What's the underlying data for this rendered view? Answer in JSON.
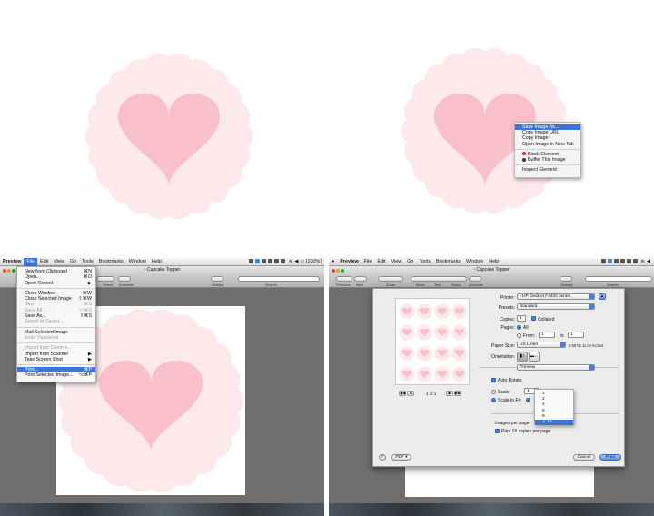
{
  "colors": {
    "badge": "#fde8ec",
    "heart": "#f9c0cb",
    "selection": "#3c74d8"
  },
  "context_menu": {
    "items": [
      {
        "label": "Save Image As...",
        "selected": true
      },
      {
        "label": "Copy Image URL"
      },
      {
        "label": "Copy Image"
      },
      {
        "label": "Open Image in New Tab"
      },
      {
        "label": "Block Element",
        "icon": "stop-icon"
      },
      {
        "label": "Buffer This Image",
        "icon": "buffer-icon"
      },
      {
        "label": "Inspect Element"
      }
    ]
  },
  "left_panel": {
    "menubar": [
      "Preview",
      "File",
      "Edit",
      "View",
      "Go",
      "Tools",
      "Bookmarks",
      "Window",
      "Help"
    ],
    "battery": "(100%)",
    "window_title": "Cupcake Topper",
    "toolbar": {
      "select": "Select",
      "annotate": "Annotate",
      "sidebar": "Sidebar",
      "search": "Search"
    },
    "file_menu": [
      {
        "label": "New from Clipboard",
        "shortcut": "⌘N"
      },
      {
        "label": "Open...",
        "shortcut": "⌘O"
      },
      {
        "label": "Open Recent",
        "shortcut": "▶"
      },
      {
        "sep": true
      },
      {
        "label": "Close Window",
        "shortcut": "⌘W"
      },
      {
        "label": "Close Selected Image",
        "shortcut": "⇧⌘W"
      },
      {
        "label": "Save",
        "shortcut": "⌘S",
        "disabled": true
      },
      {
        "label": "Save All",
        "shortcut": "⌥⌘S",
        "disabled": true
      },
      {
        "label": "Save As...",
        "shortcut": "⇧⌘S"
      },
      {
        "label": "Revert to Saved...",
        "disabled": true
      },
      {
        "sep": true
      },
      {
        "label": "Mail Selected Image"
      },
      {
        "label": "Enter Password",
        "disabled": true
      },
      {
        "sep": true
      },
      {
        "label": "Import from Camera...",
        "disabled": true
      },
      {
        "label": "Import from Scanner",
        "shortcut": "▶"
      },
      {
        "label": "Take Screen Shot",
        "shortcut": "▶"
      },
      {
        "sep": true
      },
      {
        "label": "Print...",
        "shortcut": "⌘P",
        "selected": true
      },
      {
        "label": "Print Selected Image...",
        "shortcut": "⌥⌘P"
      }
    ]
  },
  "right_panel": {
    "menubar": [
      "Preview",
      "File",
      "Edit",
      "View",
      "Go",
      "Tools",
      "Bookmarks",
      "Window",
      "Help"
    ],
    "window_title": "Cupcake Topper",
    "toolbar": {
      "previous": "Previous",
      "next": "Next",
      "zoom": "Zoom",
      "move": "Move",
      "text": "Text",
      "select": "Select",
      "annotate": "Annotate",
      "sidebar": "Sidebar",
      "search": "Search"
    },
    "print_dialog": {
      "page_count": "1 of 1",
      "printer_label": "Printer:",
      "printer_value": "HP Deskjet F4400 series",
      "presets_label": "Presets:",
      "presets_value": "Standard",
      "copies_label": "Copies:",
      "copies_value": "1",
      "collated_label": "Collated",
      "pages_label": "Pages:",
      "all_label": "All",
      "from_label": "From:",
      "from_value": "1",
      "to_label": "to:",
      "to_value": "1",
      "paper_size_label": "Paper Size:",
      "paper_size_value": "US Letter",
      "paper_size_dims": "8.50 by 11.00 inches",
      "orientation_label": "Orientation:",
      "section_value": "Preview",
      "auto_rotate_label": "Auto Rotate",
      "scale_label": "Scale:",
      "scale_value": "1",
      "scale_to_fit_label": "Scale to Fit:",
      "images_per_page_label": "Images per page:",
      "images_per_page_options": [
        "1",
        "2",
        "4",
        "6",
        "9",
        "16"
      ],
      "images_per_page_selected": "16",
      "print_copies_label": "Print 16 copies per page",
      "help_label": "?",
      "pdf_label": "PDF ▾",
      "cancel_label": "Cancel",
      "print_label": "Print"
    }
  }
}
